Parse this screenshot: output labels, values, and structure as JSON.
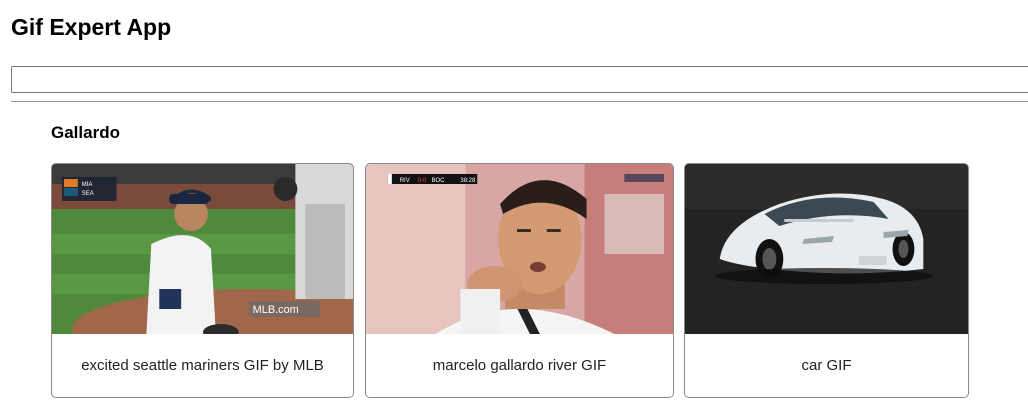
{
  "app": {
    "title": "Gif Expert App"
  },
  "search": {
    "value": "",
    "placeholder": ""
  },
  "category": {
    "name": "Gallardo"
  },
  "gifs": [
    {
      "title": "excited seattle mariners GIF by MLB",
      "overlay": {
        "score_home": "MIA",
        "score_away": "SEA",
        "watermark": "MLB.com"
      }
    },
    {
      "title": "marcelo gallardo river GIF",
      "overlay": {
        "team_a": "RIV",
        "team_b": "BOC",
        "score": "0-0",
        "clock": "38:28"
      }
    },
    {
      "title": "car GIF"
    }
  ]
}
